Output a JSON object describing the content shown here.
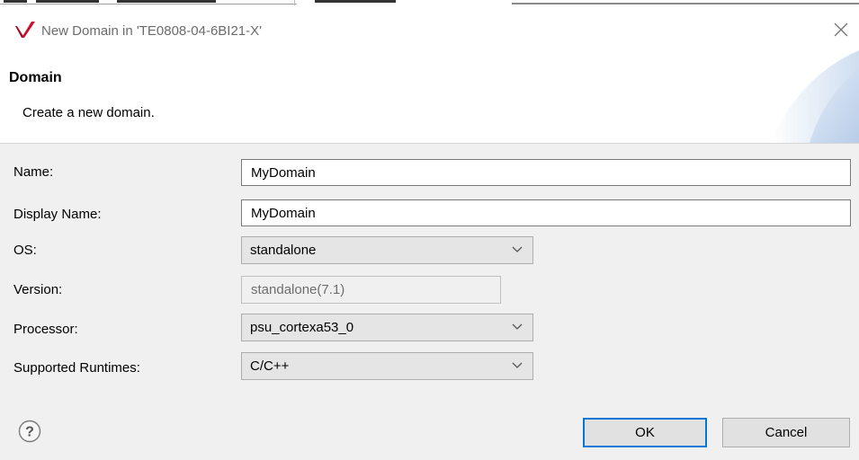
{
  "window": {
    "title": "New Domain in 'TE0808-04-6BI21-X'",
    "close_glyph": "×"
  },
  "banner": {
    "title": "Domain",
    "subtitle": "Create a new domain."
  },
  "form": {
    "name": {
      "label": "Name:",
      "value": "MyDomain"
    },
    "display_name": {
      "label": "Display Name:",
      "value": "MyDomain"
    },
    "os": {
      "label": "OS:",
      "value": "standalone"
    },
    "version": {
      "label": "Version:",
      "value": "standalone(7.1)"
    },
    "processor": {
      "label": "Processor:",
      "value": "psu_cortexa53_0"
    },
    "runtimes": {
      "label": "Supported Runtimes:",
      "value": "C/C++"
    }
  },
  "buttons": {
    "ok": "OK",
    "cancel": "Cancel",
    "help_glyph": "?"
  },
  "icons": {
    "app": "vitis-logo-icon",
    "close": "close-icon",
    "chevron": "chevron-down-icon",
    "help": "help-icon"
  },
  "colors": {
    "accent": "#0078d7",
    "logo": "#c8102e",
    "content_bg": "#f0f0f0"
  }
}
